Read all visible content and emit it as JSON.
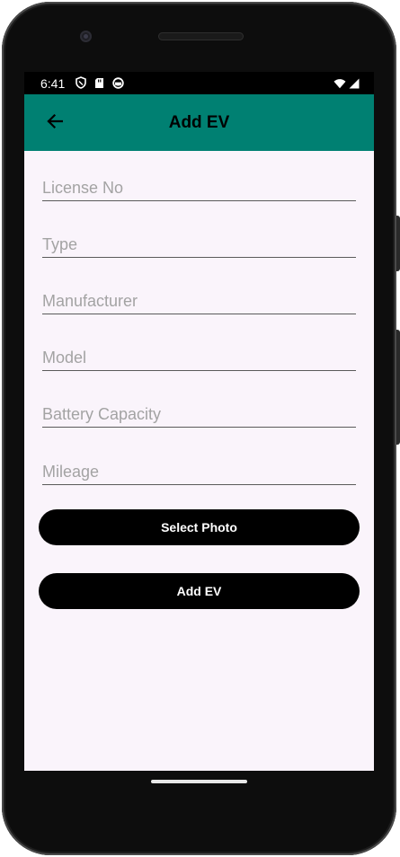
{
  "status_bar": {
    "time": "6:41",
    "icons": [
      "shield-icon",
      "sd-card-icon",
      "app-notification-icon"
    ],
    "right_icons": [
      "wifi-icon",
      "cell-signal-icon"
    ]
  },
  "app_bar": {
    "title": "Add EV",
    "background_color": "#008072",
    "back_icon": "arrow-back-icon"
  },
  "form": {
    "fields": [
      {
        "name": "license-no-field",
        "value": "",
        "placeholder": "License No"
      },
      {
        "name": "type-field",
        "value": "",
        "placeholder": "Type"
      },
      {
        "name": "manufacturer-field",
        "value": "",
        "placeholder": "Manufacturer"
      },
      {
        "name": "model-field",
        "value": "",
        "placeholder": "Model"
      },
      {
        "name": "battery-capacity-field",
        "value": "",
        "placeholder": "Battery Capacity"
      },
      {
        "name": "mileage-field",
        "value": "",
        "placeholder": "Mileage"
      }
    ],
    "select_photo_label": "Select Photo",
    "add_ev_label": "Add EV"
  },
  "colors": {
    "screen_background": "#faf4fb",
    "button_background": "#000000",
    "button_text": "#ffffff"
  }
}
